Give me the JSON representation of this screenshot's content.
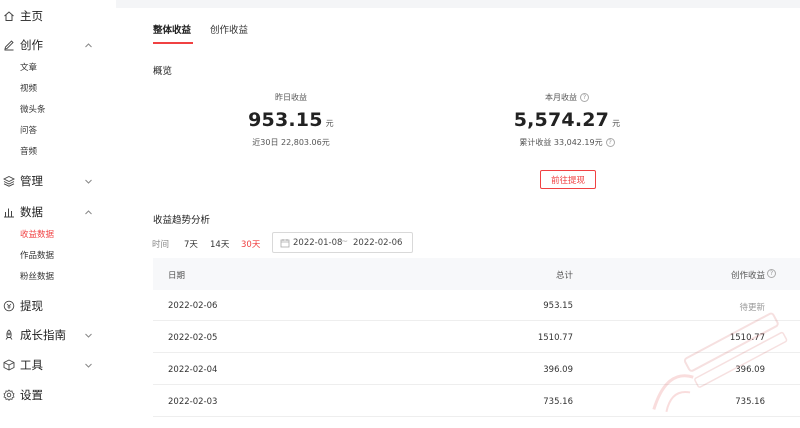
{
  "sidebar": {
    "home": "主页",
    "create": "创作",
    "create_items": [
      "文章",
      "视频",
      "微头条",
      "问答",
      "音频"
    ],
    "manage": "管理",
    "data": "数据",
    "data_items": [
      "收益数据",
      "作品数据",
      "粉丝数据"
    ],
    "withdraw": "提现",
    "growth": "成长指南",
    "tools": "工具",
    "settings": "设置"
  },
  "tabs": [
    "整体收益",
    "创作收益"
  ],
  "overview": {
    "title": "概览",
    "yesterday_label": "昨日收益",
    "yesterday_value": "953.15",
    "yesterday_unit": "元",
    "last30": "近30日 22,803.06元",
    "month_label": "本月收益",
    "month_value": "5,574.27",
    "month_unit": "元",
    "total": "累计收益 33,042.19元",
    "withdraw_button": "前往提现"
  },
  "trend": {
    "title": "收益趋势分析",
    "range_label": "时间",
    "ranges": [
      "7天",
      "14天",
      "30天"
    ],
    "date_start": "2022-01-08",
    "date_end": "2022-02-06",
    "date_sep": "~"
  },
  "table": {
    "headers": [
      "日期",
      "总计",
      "创作收益"
    ],
    "rows": [
      {
        "date": "2022-02-06",
        "total": "953.15",
        "creation": "待更新"
      },
      {
        "date": "2022-02-05",
        "total": "1510.77",
        "creation": "1510.77"
      },
      {
        "date": "2022-02-04",
        "total": "396.09",
        "creation": "396.09"
      },
      {
        "date": "2022-02-03",
        "total": "735.16",
        "creation": "735.16"
      }
    ]
  },
  "colors": {
    "accent": "#f04142",
    "page_bg": "#f4f5f7"
  }
}
